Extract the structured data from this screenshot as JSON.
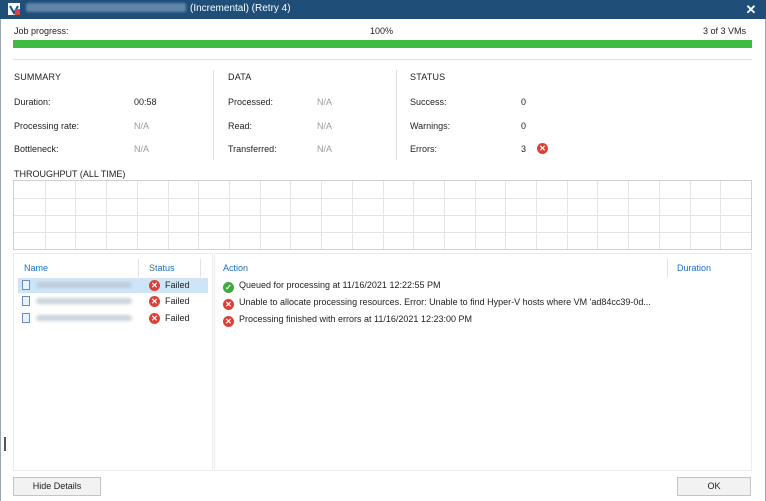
{
  "window": {
    "title_suffix": "(Incremental) (Retry 4)",
    "close_glyph": "✕"
  },
  "progress": {
    "label": "Job progress:",
    "percent_text": "100%",
    "count_text": "3 of 3 VMs",
    "fraction": 1.0,
    "color": "#3fba43"
  },
  "summary": {
    "heading": "SUMMARY",
    "duration_label": "Duration:",
    "duration_value": "00:58",
    "rate_label": "Processing rate:",
    "rate_value": "N/A",
    "bottleneck_label": "Bottleneck:",
    "bottleneck_value": "N/A"
  },
  "data": {
    "heading": "DATA",
    "processed_label": "Processed:",
    "processed_value": "N/A",
    "read_label": "Read:",
    "read_value": "N/A",
    "transferred_label": "Transferred:",
    "transferred_value": "N/A"
  },
  "status": {
    "heading": "STATUS",
    "success_label": "Success:",
    "success_value": "0",
    "warnings_label": "Warnings:",
    "warnings_value": "0",
    "errors_label": "Errors:",
    "errors_value": "3"
  },
  "throughput": {
    "heading": "THROUGHPUT (ALL TIME)"
  },
  "vm_list": {
    "name_header": "Name",
    "status_header": "Status",
    "rows": [
      {
        "status": "Failed",
        "selected": true
      },
      {
        "status": "Failed",
        "selected": false
      },
      {
        "status": "Failed",
        "selected": false
      }
    ]
  },
  "log": {
    "action_header": "Action",
    "duration_header": "Duration",
    "entries": [
      {
        "type": "success",
        "text": "Queued for processing at 11/16/2021 12:22:55 PM"
      },
      {
        "type": "error",
        "text": "Unable to allocate processing resources. Error: Unable to find Hyper-V hosts where VM 'ad84cc39-0d..."
      },
      {
        "type": "error",
        "text": "Processing finished with errors at 11/16/2021 12:23:00 PM"
      }
    ]
  },
  "buttons": {
    "hide_details": "Hide Details",
    "ok": "OK"
  },
  "colors": {
    "titlebar": "#1f4e79",
    "success": "#3fab3f",
    "error": "#d9423a",
    "link_header": "#1a6fb8",
    "selection": "#cde6f7"
  }
}
